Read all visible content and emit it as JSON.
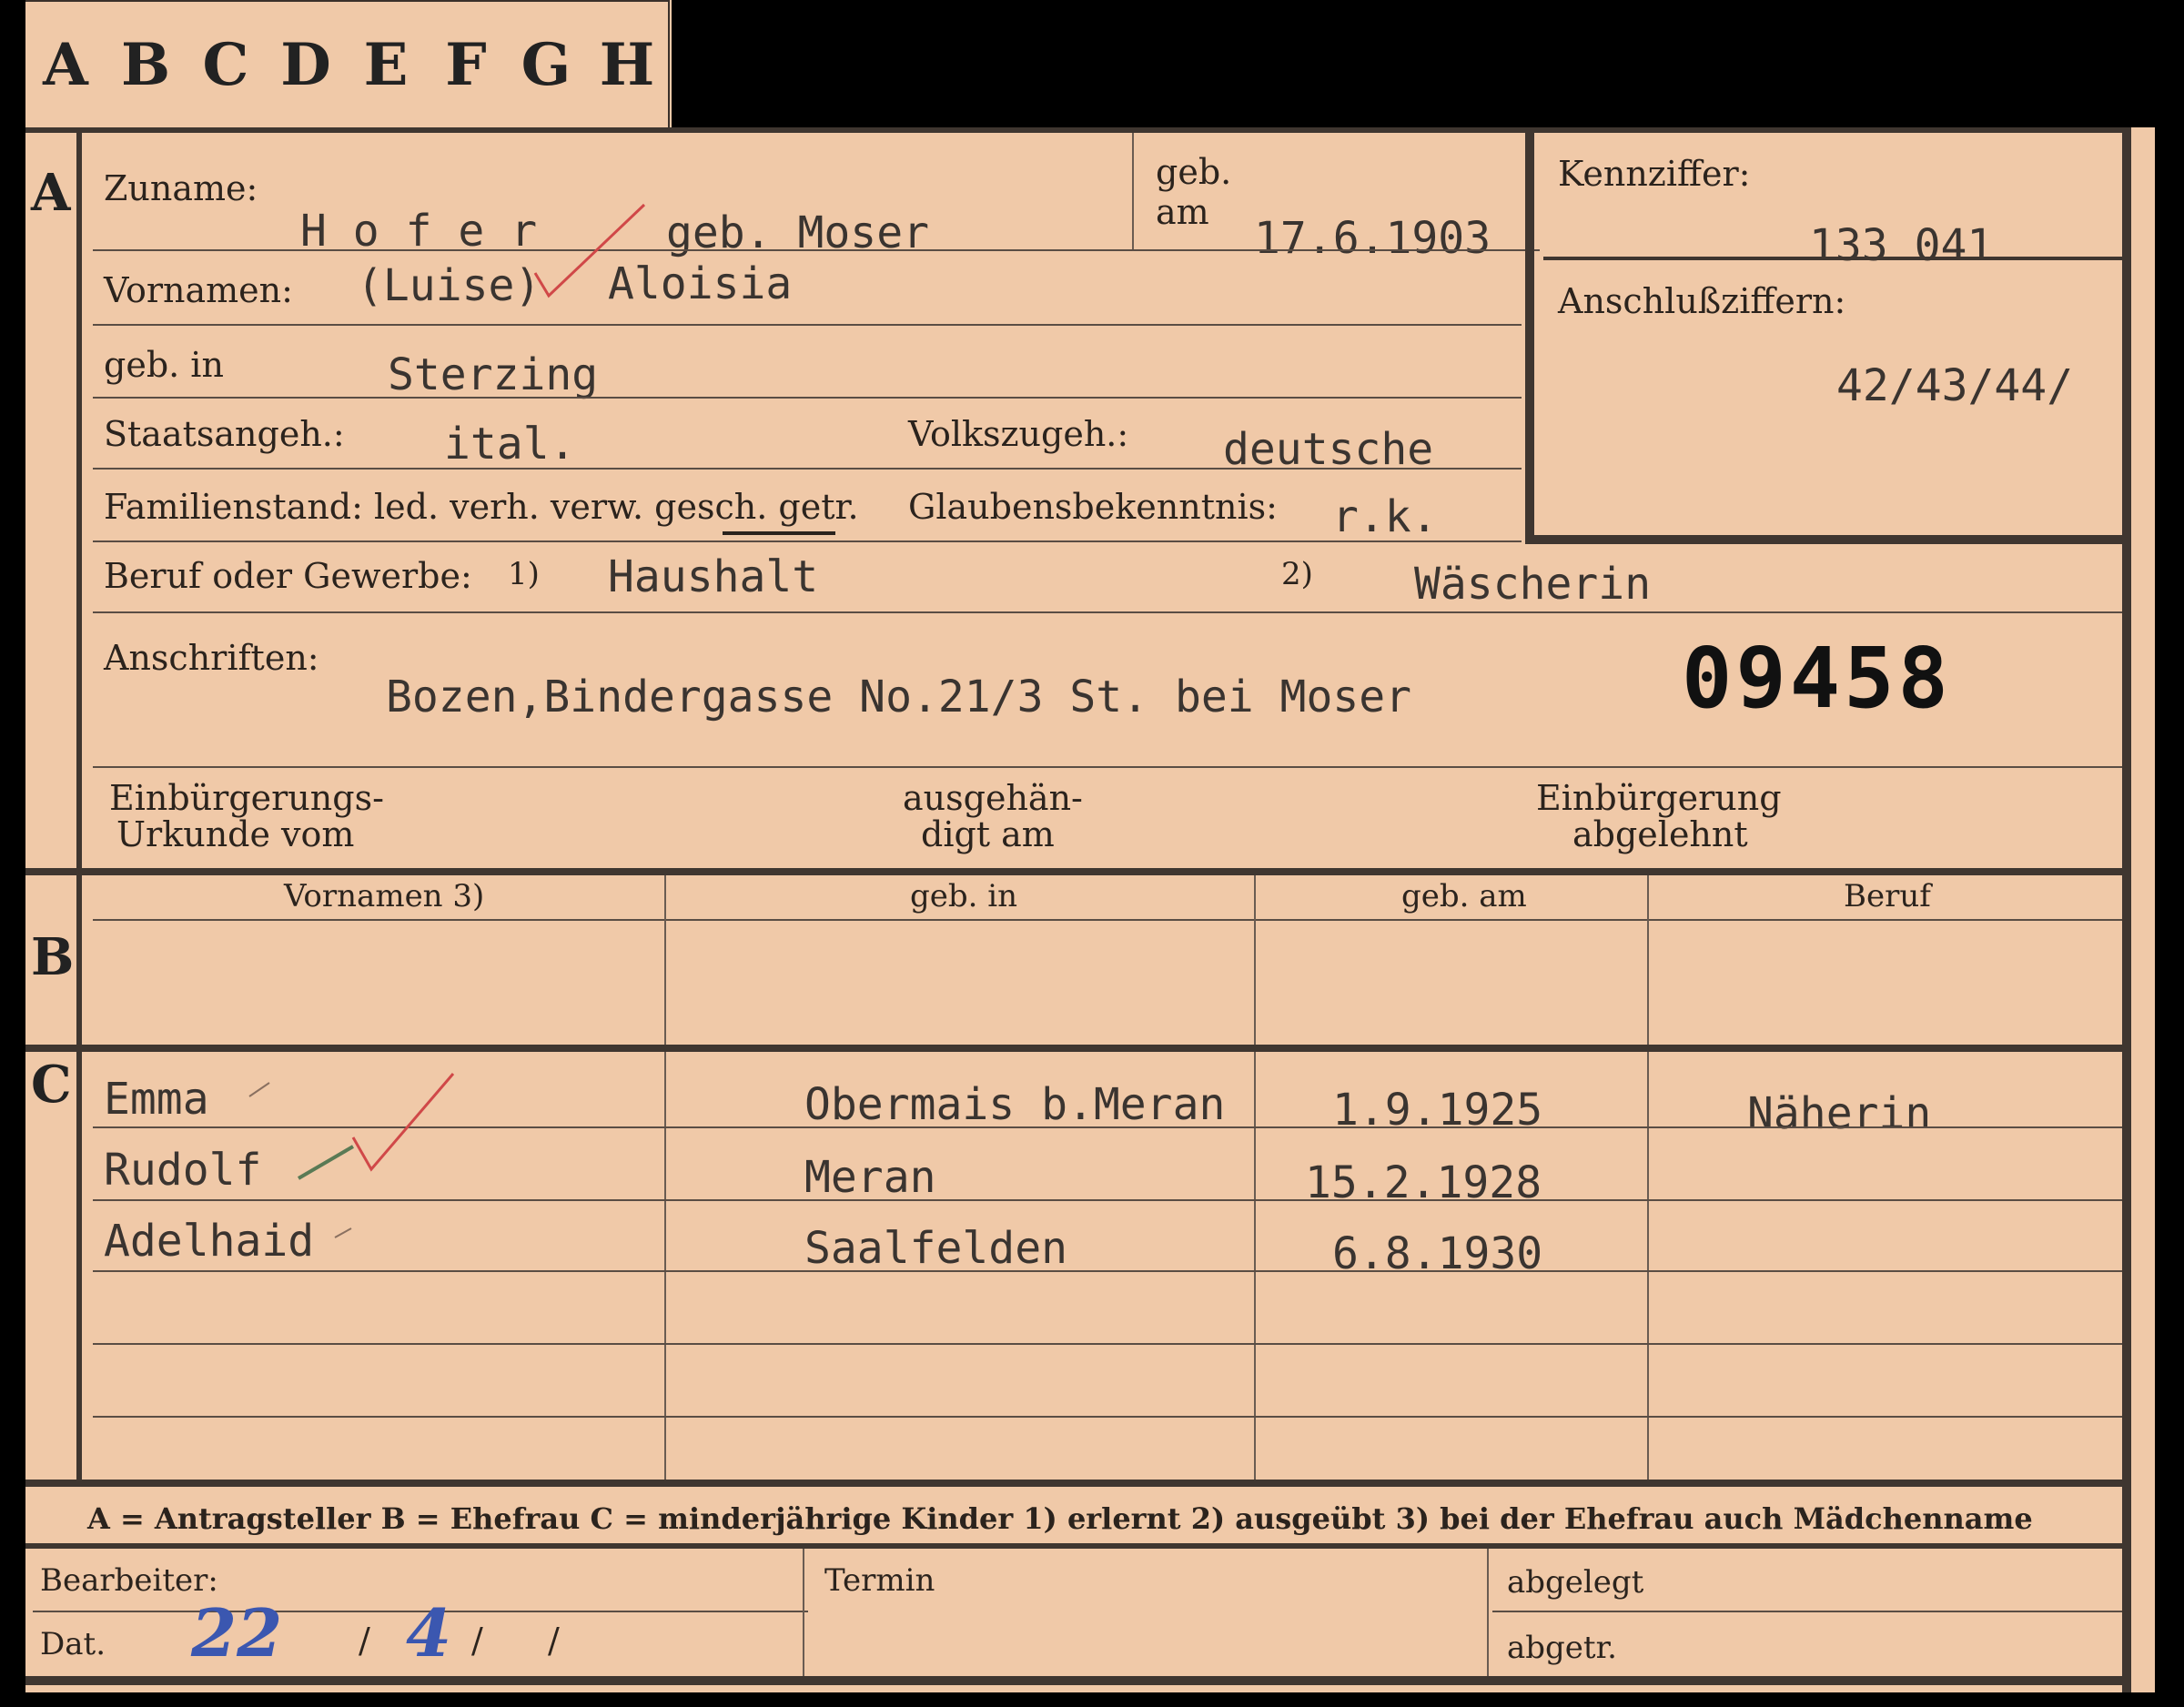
{
  "tabs": [
    "A",
    "B",
    "C",
    "D",
    "E",
    "F",
    "G",
    "H"
  ],
  "sections": {
    "a": "A",
    "b": "B",
    "c": "C"
  },
  "labels": {
    "zuname": "Zuname:",
    "geb_am_1": "geb.",
    "geb_am_2": "am",
    "kennziffer": "Kennziffer:",
    "anschluss": "Anschlußziffern:",
    "vornamen": "Vornamen:",
    "geb_in": "geb. in",
    "staatsangeh": "Staatsangeh.:",
    "volkszugeh": "Volkszugeh.:",
    "familienstand": "Familienstand: led. verh. verw. gesch. getr.",
    "glauben": "Glaubensbekenntnis:",
    "beruf": "Beruf oder Gewerbe:",
    "beruf_fn1": "1)",
    "beruf_fn2": "2)",
    "anschriften": "Anschriften:",
    "einb_urk_1": "Einbürgerungs-",
    "einb_urk_2": "Urkunde vom",
    "ausgeh_1": "ausgehän-",
    "ausgeh_2": "digt am",
    "einb_abg_1": "Einbürgerung",
    "einb_abg_2": "abgelehnt"
  },
  "person": {
    "surname": "H o f e r",
    "geb_name": "geb. Moser",
    "birth_date": "17.6.1903",
    "kennziffer": "133 041",
    "anschlussziffern": "42/43/44/",
    "first_names_bracket": "(Luise)",
    "first_names": "Aloisia",
    "birthplace": "Sterzing",
    "citizenship": "ital.",
    "ethnicity": "deutsche",
    "religion": "r.k.",
    "occupation_1": "Haushalt",
    "occupation_2": "Wäscherin",
    "address": "Bozen,Bindergasse No.21/3  St. bei Moser",
    "stamp_number": "09458"
  },
  "spouse_table": {
    "headers": [
      "Vornamen 3)",
      "geb. in",
      "geb. am",
      "Beruf"
    ]
  },
  "children": [
    {
      "name": "Emma",
      "place": "Obermais b.Meran",
      "date": "1.9.1925",
      "job": "Näherin"
    },
    {
      "name": "Rudolf",
      "place": "Meran",
      "date": "15.2.1928",
      "job": ""
    },
    {
      "name": "Adelhaid",
      "place": "Saalfelden",
      "date": "6.8.1930",
      "job": ""
    }
  ],
  "legend": "A = Antragsteller   B = Ehefrau   C = minderjährige Kinder   1) erlernt   2) ausgeübt   3) bei der Ehefrau auch Mädchenname",
  "bottom": {
    "bearbeiter": "Bearbeiter:",
    "dat": "Dat.",
    "termin": "Termin",
    "abgelegt": "abgelegt",
    "abgetr": "abgetr.",
    "date_day": "22",
    "date_month": "4",
    "sep1": "/",
    "sep2": "/",
    "sep3": "/"
  },
  "colors": {
    "card": "#f0c9a8",
    "ink": "#2b231d",
    "blue_pencil": "#3b57b0",
    "red_pencil": "#d04848"
  }
}
